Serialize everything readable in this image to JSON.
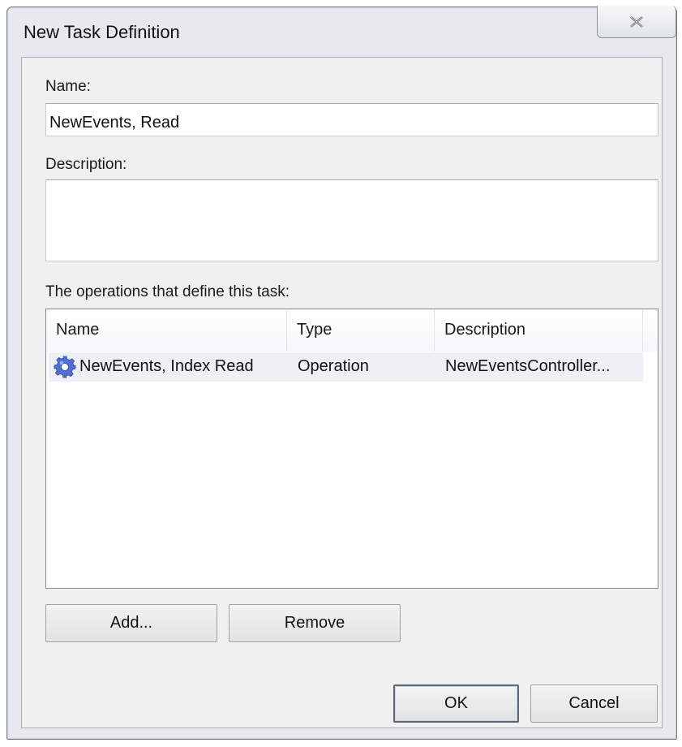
{
  "window": {
    "title": "New Task Definition",
    "close_icon": "close-icon"
  },
  "form": {
    "name_label": "Name:",
    "name_value": "NewEvents, Read",
    "description_label": "Description:",
    "description_value": "",
    "operations_label": "The operations that define this task:"
  },
  "operations_table": {
    "columns": [
      "Name",
      "Type",
      "Description"
    ],
    "rows": [
      {
        "icon": "gear-icon",
        "name": "NewEvents, Index Read",
        "type": "Operation",
        "description": "NewEventsController..."
      }
    ]
  },
  "buttons": {
    "add": "Add...",
    "remove": "Remove",
    "ok": "OK",
    "cancel": "Cancel"
  },
  "colors": {
    "icon_blue": "#4f6fd3",
    "row_highlight": "#eef0f3"
  }
}
